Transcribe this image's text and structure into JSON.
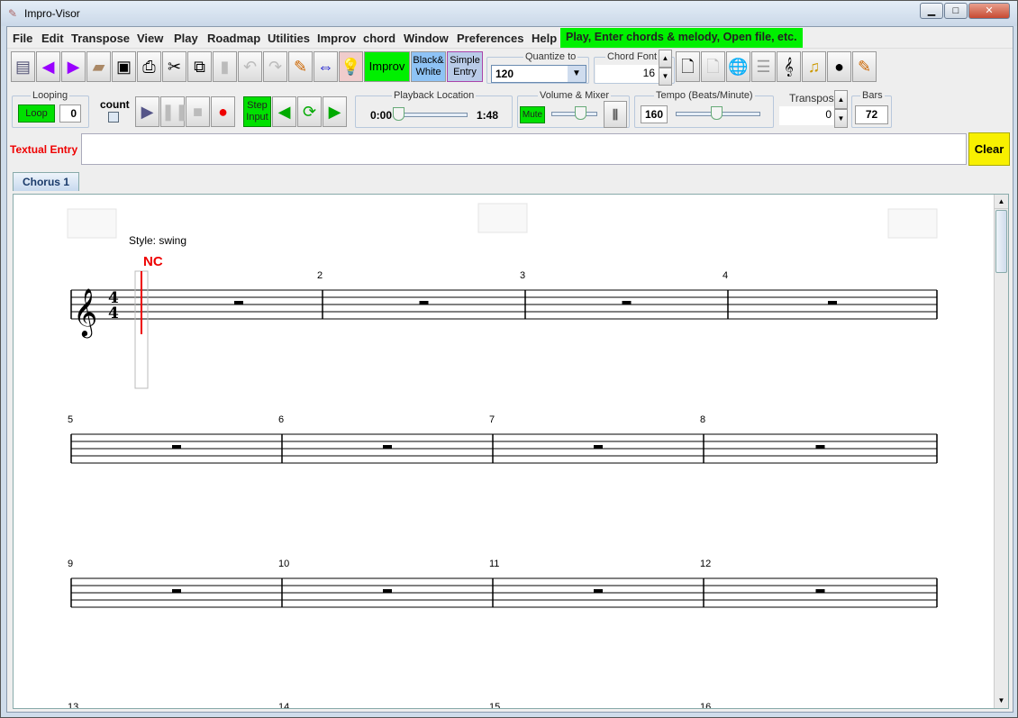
{
  "window": {
    "title": "Impro-Visor",
    "minimize": "▁",
    "maximize": "□",
    "close": "✕"
  },
  "menu": {
    "items": [
      "File",
      "Edit",
      "Transpose",
      "View",
      "Play",
      "Roadmap",
      "Utilities",
      "Improv",
      "chord",
      "Window",
      "Preferences",
      "Help"
    ],
    "hint": "Play, Enter chords & melody, Open file, etc."
  },
  "toolbar": {
    "improv": "Improv",
    "bw_line1": "Black&",
    "bw_line2": "White",
    "simple_line1": "Simple",
    "simple_line2": "Entry",
    "quantize_label": "Quantize to",
    "quantize_value": "120",
    "chord_font_label": "Chord Font",
    "chord_font_value": "16"
  },
  "playbar": {
    "looping_label": "Looping",
    "loop_button": "Loop",
    "loop_count": "0",
    "count_label": "count",
    "step_line1": "Step",
    "step_line2": "Input",
    "playback_label": "Playback Location",
    "time_start": "0:00",
    "time_end": "1:48",
    "playback_progress": 0,
    "volume_label": "Volume & Mixer",
    "mute": "Mute",
    "volume_level": 0.6,
    "tempo_label": "Tempo (Beats/Minute)",
    "tempo_value": "160",
    "tempo_level": 0.45,
    "transpose_label": "Transpose",
    "transpose_value": "0",
    "bars_label": "Bars",
    "bars_value": "72"
  },
  "textual_entry": {
    "label": "Textual Entry",
    "value": "",
    "clear": "Clear"
  },
  "tabs": [
    {
      "label": "Chorus 1"
    }
  ],
  "score": {
    "style": "Style: swing",
    "chord": "NC",
    "time_signature": [
      "4",
      "4"
    ],
    "rows": [
      [
        "",
        "2",
        "3",
        "4"
      ],
      [
        "5",
        "6",
        "7",
        "8"
      ],
      [
        "9",
        "10",
        "11",
        "12"
      ]
    ],
    "partial_row": [
      "13",
      "14",
      "15",
      "16"
    ]
  },
  "colors": {
    "green": "#00e000",
    "red": "#e00000",
    "accent_blue": "#8ec3f5"
  }
}
